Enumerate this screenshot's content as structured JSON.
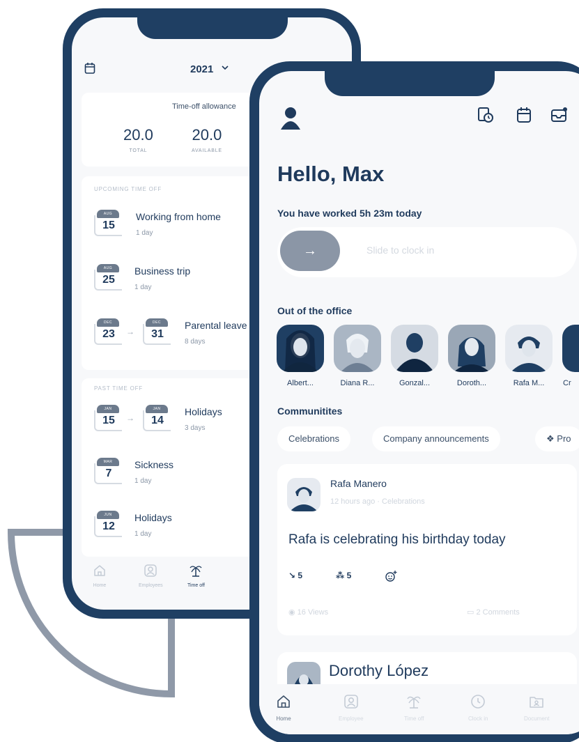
{
  "colors": {
    "navy": "#1f3f63",
    "screen_bg": "#f7f8fa",
    "muted": "#8b97a7",
    "arc": "#8f99a8"
  },
  "back_phone": {
    "year": "2021",
    "allowance": {
      "title": "Time-off allowance",
      "stats": [
        {
          "value": "20.0",
          "label": "TOTAL"
        },
        {
          "value": "20.0",
          "label": "AVAILABLE"
        }
      ]
    },
    "upcoming": {
      "title": "UPCOMING TIME OFF",
      "items": [
        {
          "month": "AUG",
          "day": "15",
          "title": "Working from home",
          "sub": "1 day"
        },
        {
          "month": "AUG",
          "day": "25",
          "title": "Business trip",
          "sub": "1 day"
        },
        {
          "month": "DEC",
          "day": "23",
          "month2": "DEC",
          "day2": "31",
          "title": "Parental leave",
          "sub": "8 days"
        }
      ]
    },
    "past": {
      "title": "PAST TIME OFF",
      "items": [
        {
          "month": "JAN",
          "day": "15",
          "month2": "JAN",
          "day2": "14",
          "title": "Holidays",
          "sub": "3 days"
        },
        {
          "month": "MAR",
          "day": "7",
          "title": "Sickness",
          "sub": "1 day"
        },
        {
          "month": "JUN",
          "day": "12",
          "title": "Holidays",
          "sub": "1 day"
        }
      ]
    },
    "nav": [
      {
        "label": "Home",
        "icon": "home-icon"
      },
      {
        "label": "Employees",
        "icon": "employees-icon"
      },
      {
        "label": "Time off",
        "icon": "palm-tree-icon",
        "active": true
      }
    ]
  },
  "front_phone": {
    "greeting": "Hello, Max",
    "worked": "You have worked 5h 23m today",
    "slider": {
      "arrow": "→",
      "text": "Slide to clock in"
    },
    "out_of_office": {
      "title": "Out of the office",
      "people": [
        "Albert...",
        "Diana R...",
        "Gonzal...",
        "Doroth...",
        "Rafa M...",
        "Cr"
      ]
    },
    "communities": {
      "title": "Communitites",
      "chips": [
        "Celebrations",
        "Company announcements",
        "Pro"
      ]
    },
    "post": {
      "author": "Rafa Manero",
      "time": "12 hours ago",
      "category": "Celebrations",
      "body": "Rafa is celebrating his birthday today",
      "reactions": [
        "5",
        "5"
      ],
      "views": "16 Views",
      "comments": "2 Comments"
    },
    "post2": {
      "author": "Dorothy López"
    },
    "nav": [
      {
        "label": "Home",
        "icon": "home-icon",
        "active": true
      },
      {
        "label": "Employee",
        "icon": "employee-icon"
      },
      {
        "label": "Time off",
        "icon": "palm-tree-icon"
      },
      {
        "label": "Clock in",
        "icon": "clock-icon"
      },
      {
        "label": "Document",
        "icon": "document-icon"
      }
    ]
  }
}
